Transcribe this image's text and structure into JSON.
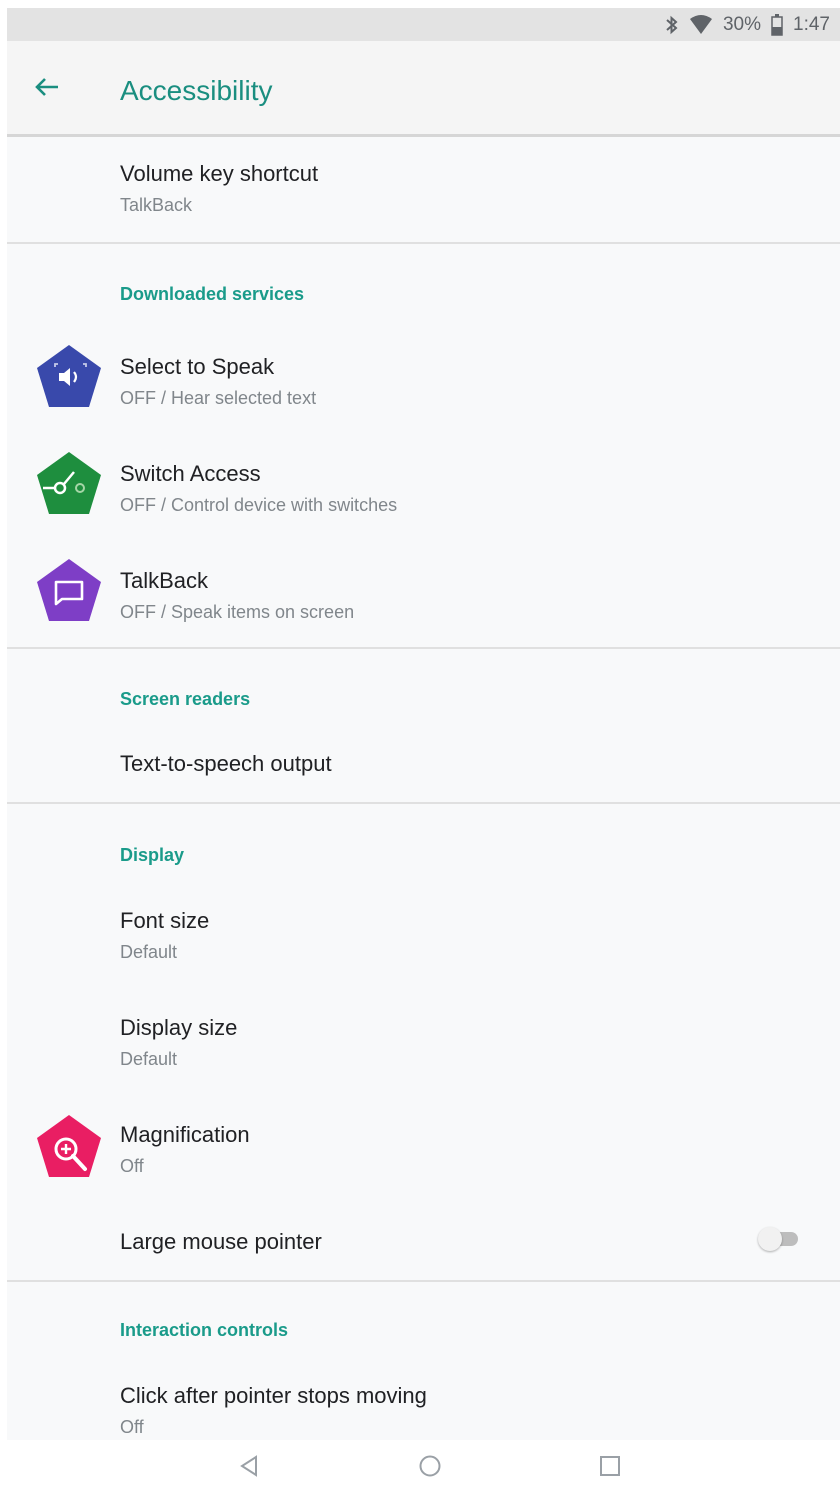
{
  "status_bar": {
    "battery": "30%",
    "time": "1:47",
    "icons": [
      "bluetooth-icon",
      "wifi-icon",
      "battery-icon"
    ]
  },
  "app_bar": {
    "title": "Accessibility",
    "back_icon": "arrow-back-icon"
  },
  "items": {
    "volume_key": {
      "title": "Volume key shortcut",
      "summary": "TalkBack"
    },
    "downloaded_header": "Downloaded services",
    "select_to_speak": {
      "title": "Select to Speak",
      "summary": "OFF / Hear selected text",
      "icon": "select-to-speak-icon",
      "color": "#3949ab"
    },
    "switch_access": {
      "title": "Switch Access",
      "summary": "OFF / Control device with switches",
      "icon": "switch-access-icon",
      "color": "#1e8e3e"
    },
    "talkback": {
      "title": "TalkBack",
      "summary": "OFF / Speak items on screen",
      "icon": "talkback-icon",
      "color": "#7e3ec6"
    },
    "screen_readers_header": "Screen readers",
    "tts_output": {
      "title": "Text-to-speech output"
    },
    "display_header": "Display",
    "font_size": {
      "title": "Font size",
      "summary": "Default"
    },
    "display_size": {
      "title": "Display size",
      "summary": "Default"
    },
    "magnification": {
      "title": "Magnification",
      "summary": "Off",
      "icon": "magnification-icon",
      "color": "#e91e63"
    },
    "large_pointer": {
      "title": "Large mouse pointer",
      "toggle_on": false
    },
    "interaction_header": "Interaction controls",
    "click_after_stop": {
      "title": "Click after pointer stops moving",
      "summary": "Off"
    }
  },
  "nav_bar": {
    "back": "nav-back-icon",
    "home": "nav-home-icon",
    "recents": "nav-recents-icon"
  },
  "colors": {
    "accent": "#1a8e80",
    "text_primary": "#202124",
    "text_secondary": "#80868b"
  }
}
